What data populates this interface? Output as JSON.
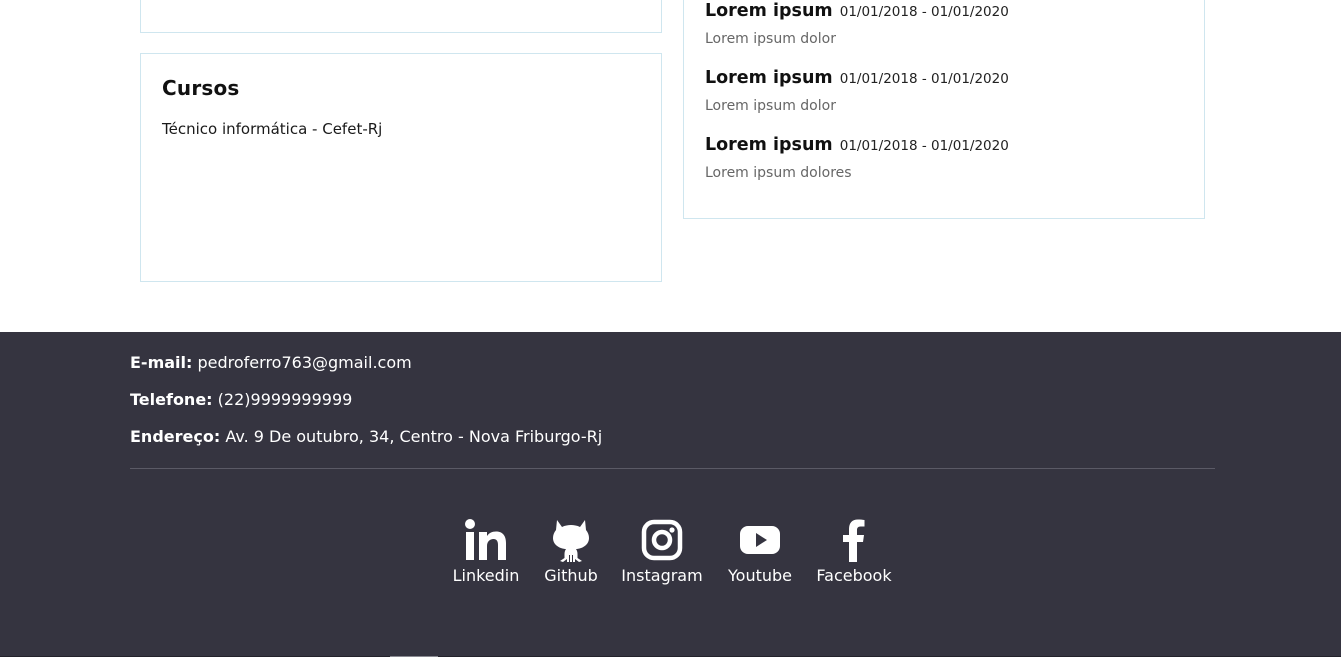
{
  "courses": {
    "title": "Cursos",
    "items": [
      "Técnico informática - Cefet-Rj"
    ]
  },
  "experience": {
    "items": [
      {
        "role": "Lorem ipsum",
        "period": "01/01/2018 - 01/01/2020",
        "description": "Lorem ipsum dolor"
      },
      {
        "role": "Lorem ipsum",
        "period": "01/01/2018 - 01/01/2020",
        "description": "Lorem ipsum dolor"
      },
      {
        "role": "Lorem ipsum",
        "period": "01/01/2018 - 01/01/2020",
        "description": "Lorem ipsum dolores"
      }
    ]
  },
  "footer": {
    "email_label": "E-mail:",
    "email": "pedroferro763@gmail.com",
    "phone_label": "Telefone:",
    "phone": "(22)9999999999",
    "address_label": "Endereço:",
    "address": "Av. 9 De outubro, 34, Centro - Nova Friburgo-Rj",
    "social": [
      {
        "label": "Linkedin",
        "icon": "linkedin-icon"
      },
      {
        "label": "Github",
        "icon": "github-icon"
      },
      {
        "label": "Instagram",
        "icon": "instagram-icon"
      },
      {
        "label": "Youtube",
        "icon": "youtube-icon"
      },
      {
        "label": "Facebook",
        "icon": "facebook-icon"
      }
    ]
  },
  "colors": {
    "footer_bg": "#353440",
    "card_border": "#cfe6ef"
  }
}
